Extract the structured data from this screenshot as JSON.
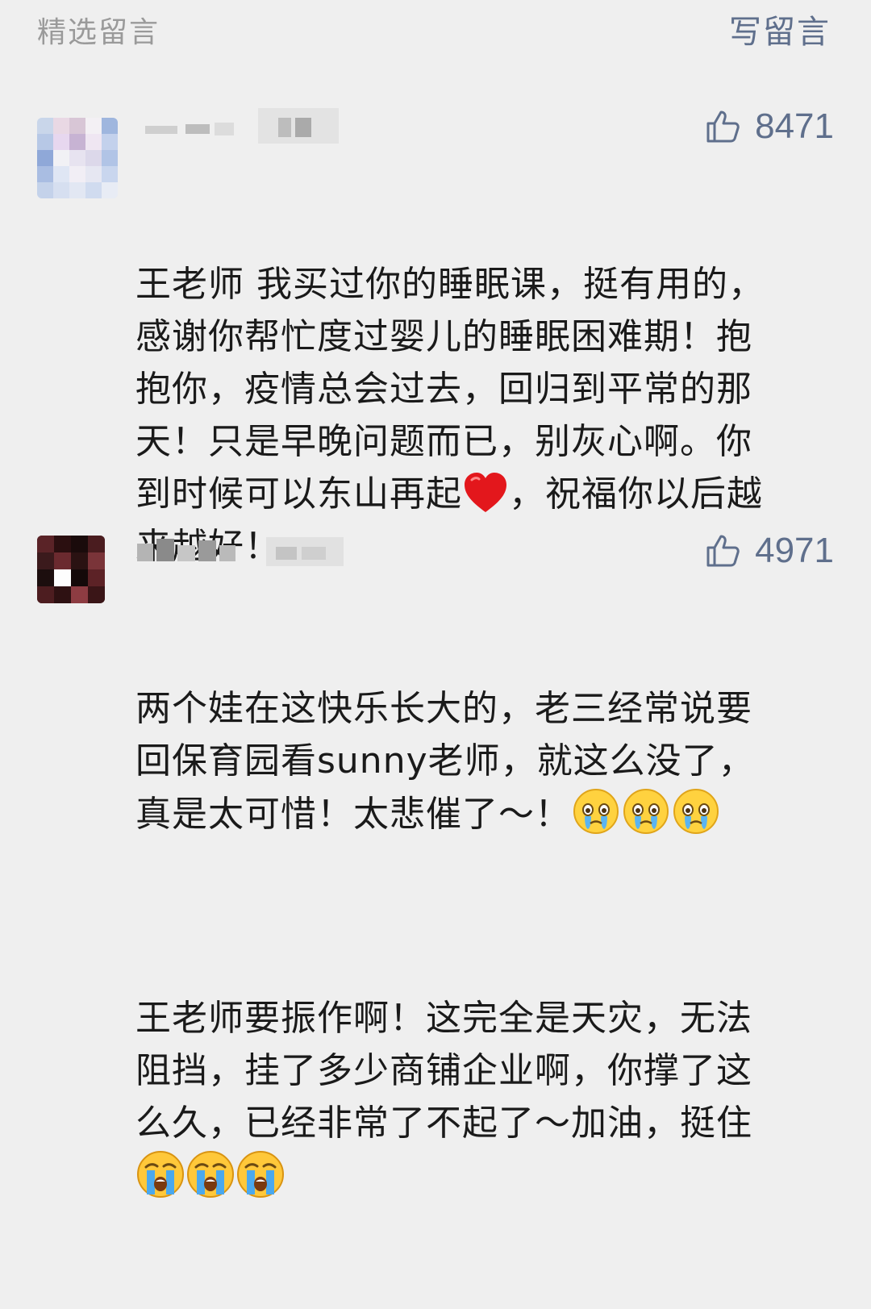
{
  "header": {
    "section_title": "精选留言",
    "write_label": "写留言"
  },
  "colors": {
    "background": "#efefef",
    "meta_text": "#9a9a9a",
    "link_blue": "#5f6f8c",
    "body_text": "#1a1a1a"
  },
  "comments": [
    {
      "likes": "8471",
      "avatar": "pixelated-avatar-light",
      "paragraphs": [
        {
          "lines": [
            "王老师 我买过你的睡眠课，挺有用的，",
            "感谢你帮忙度过婴儿的睡眠困难期！抱",
            "抱你，疫情总会过去，回归到平常的那",
            "天！只是早晚问题而已，别灰心啊。你"
          ],
          "line5_before": "到时候可以东山再起",
          "line5_emoji": "red-heart-icon",
          "line5_after": "，祝福你以后越",
          "line6": "来越好！"
        }
      ]
    },
    {
      "likes": "4971",
      "avatar": "pixelated-avatar-dark",
      "paragraphs": [
        {
          "lines": [
            "两个娃在这快乐长大的，老三经常说要",
            "回保育园看sunny老师，就这么没了，"
          ],
          "line3": "真是太可惜！太悲催了～！",
          "line3_emojis": [
            "tearful-face-icon",
            "tearful-face-icon",
            "tearful-face-icon"
          ]
        },
        {
          "lines": [
            "王老师要振作啊！这完全是天灾，无法",
            "阻挡，挂了多少商铺企业啊，你撑了这",
            "么久，已经非常了不起了～加油，挺住"
          ],
          "line4_emojis": [
            "crying-face-icon",
            "crying-face-icon",
            "crying-face-icon"
          ]
        }
      ]
    }
  ]
}
